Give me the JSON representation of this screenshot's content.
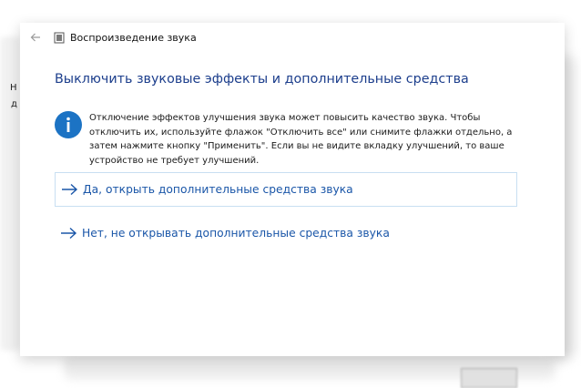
{
  "window": {
    "title": "Воспроизведение звука",
    "back_icon": "back-arrow-icon",
    "app_icon": "document-icon"
  },
  "heading": "Выключить звуковые эффекты и дополнительные средства",
  "info": {
    "icon": "info-icon",
    "text": "Отключение эффектов улучшения звука может повысить качество звука. Чтобы отключить их, используйте флажок \"Отключить все\" или снимите флажки отдельно, а затем нажмите кнопку \"Применить\". Если вы не видите вкладку улучшений, то ваше устройство не требует улучшений."
  },
  "options": [
    {
      "label": "Да, открыть дополнительные средства звука",
      "icon": "arrow-right-icon"
    },
    {
      "label": "Нет, не открывать дополнительные средства звука",
      "icon": "arrow-right-icon"
    }
  ],
  "background": {
    "fragment_1": "Н",
    "fragment_2": "д"
  },
  "colors": {
    "heading": "#1c3e8c",
    "link": "#1a56a8",
    "info_icon": "#1c73c4",
    "link_border": "#c8dff2"
  }
}
